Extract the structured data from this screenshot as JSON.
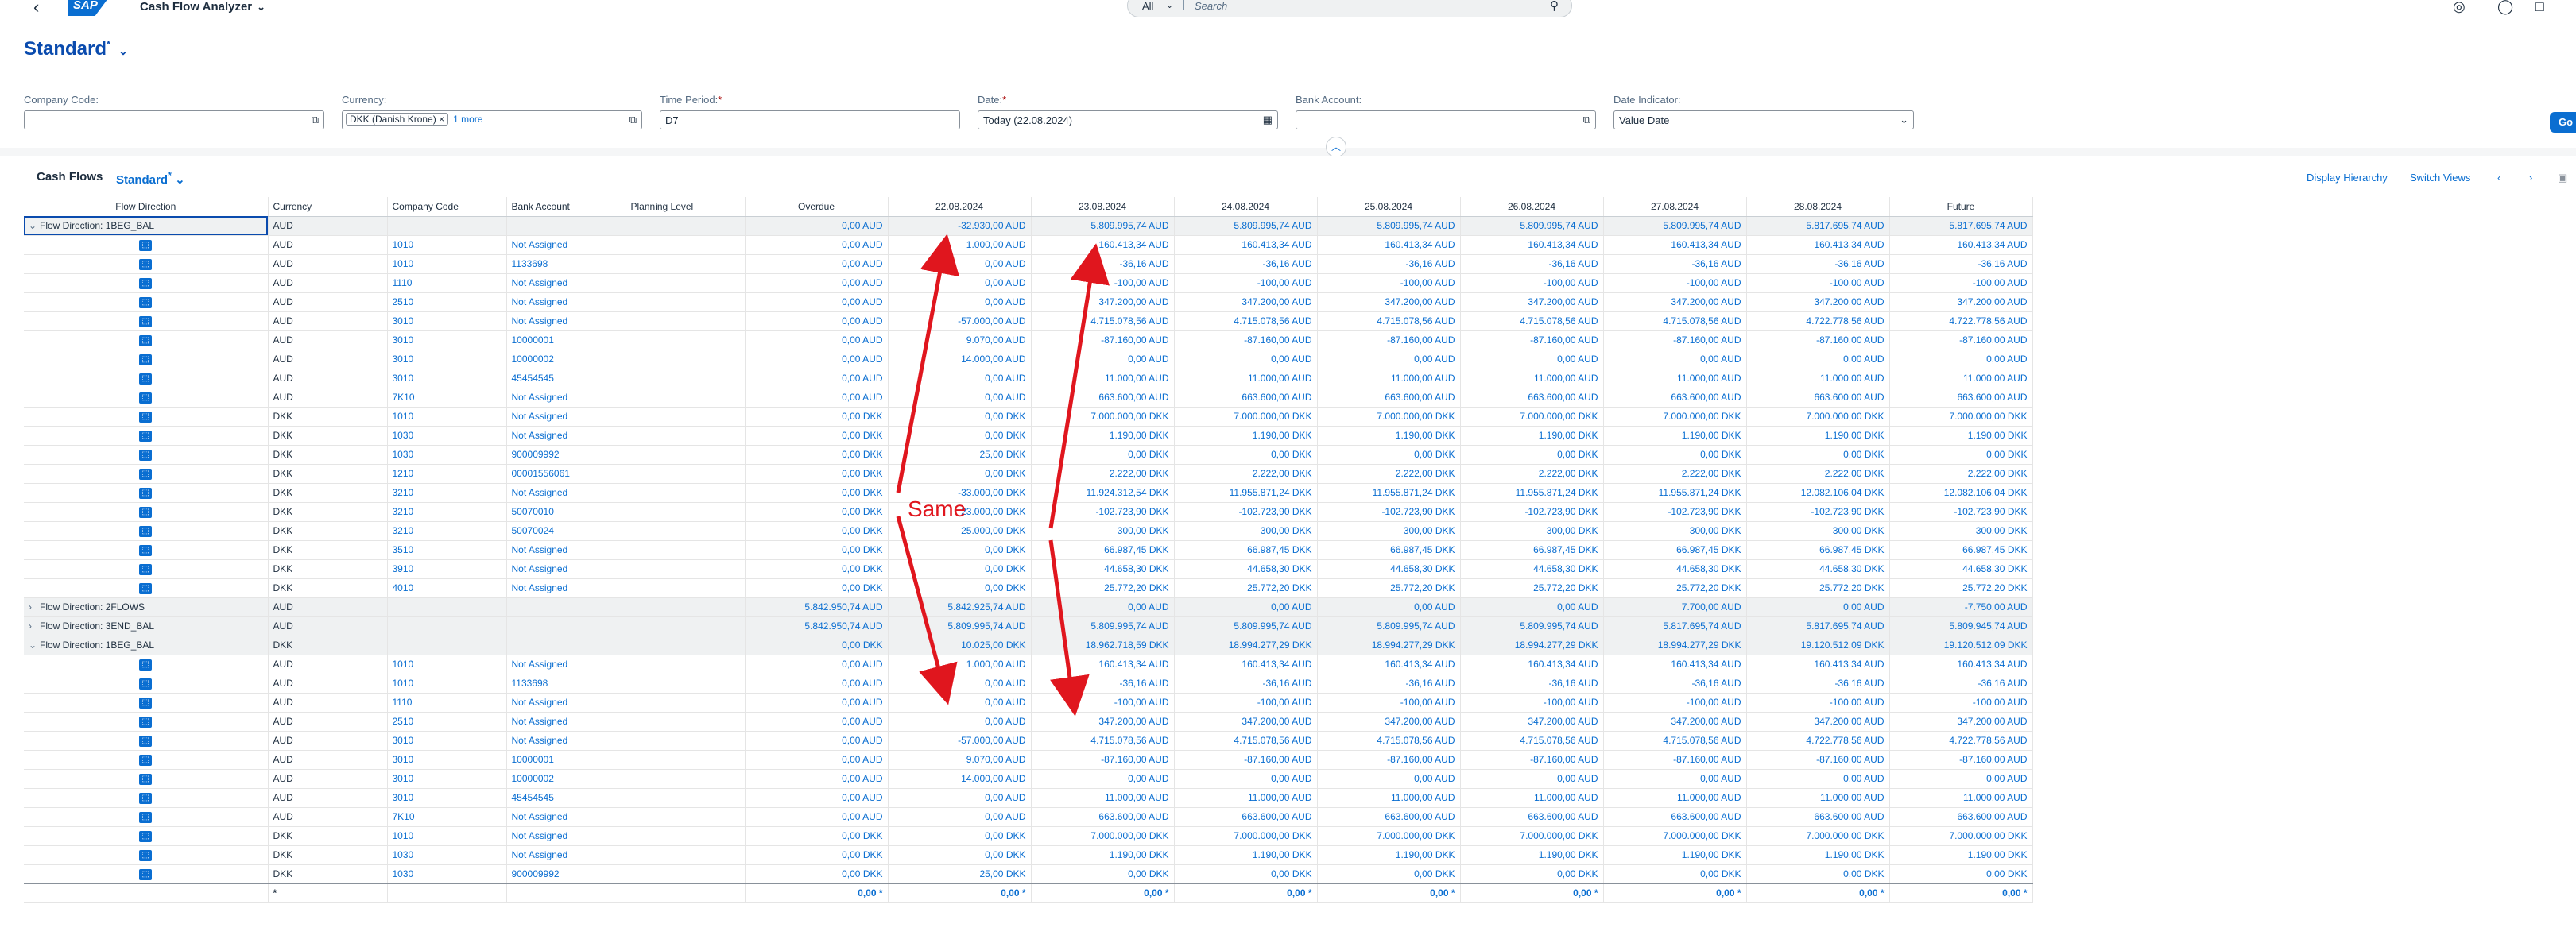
{
  "shell": {
    "app_title": "Cash Flow Analyzer",
    "search_scope": "All",
    "search_placeholder": "Search"
  },
  "header": {
    "variant": "Standard",
    "variant_mark": "*",
    "filters": {
      "company_code": {
        "label": "Company Code:",
        "value": ""
      },
      "currency": {
        "label": "Currency:",
        "token": "DKK (Danish Krone)",
        "more": "1 more"
      },
      "time_period": {
        "label": "Time Period:",
        "req": "*",
        "value": "D7"
      },
      "date": {
        "label": "Date:",
        "req": "*",
        "value": "Today (22.08.2024)"
      },
      "bank_account": {
        "label": "Bank Account:",
        "value": ""
      },
      "date_indicator": {
        "label": "Date Indicator:",
        "value": "Value Date"
      }
    },
    "go_label": "Go"
  },
  "table": {
    "title": "Cash Flows",
    "variant": "Standard",
    "variant_mark": "*",
    "toolbar": {
      "display_hierarchy": "Display Hierarchy",
      "switch_views": "Switch Views"
    },
    "columns": [
      "Flow Direction",
      "Currency",
      "Company Code",
      "Bank Account",
      "Planning Level",
      "Overdue",
      "22.08.2024",
      "23.08.2024",
      "24.08.2024",
      "25.08.2024",
      "26.08.2024",
      "27.08.2024",
      "28.08.2024",
      "Future"
    ],
    "rows": [
      {
        "type": "group",
        "dir": "Flow Direction: 1BEG_BAL",
        "exp": "v",
        "cur": "AUD",
        "vals": [
          "0,00 AUD",
          "-32.930,00 AUD",
          "5.809.995,74 AUD",
          "5.809.995,74 AUD",
          "5.809.995,74 AUD",
          "5.809.995,74 AUD",
          "5.809.995,74 AUD",
          "5.817.695,74 AUD",
          "5.817.695,74 AUD"
        ]
      },
      {
        "type": "item",
        "cur": "AUD",
        "cc": "1010",
        "ba": "Not Assigned",
        "vals": [
          "0,00 AUD",
          "1.000,00 AUD",
          "160.413,34 AUD",
          "160.413,34 AUD",
          "160.413,34 AUD",
          "160.413,34 AUD",
          "160.413,34 AUD",
          "160.413,34 AUD",
          "160.413,34 AUD"
        ]
      },
      {
        "type": "item",
        "cur": "AUD",
        "cc": "1010",
        "ba": "1133698",
        "vals": [
          "0,00 AUD",
          "0,00 AUD",
          "-36,16 AUD",
          "-36,16 AUD",
          "-36,16 AUD",
          "-36,16 AUD",
          "-36,16 AUD",
          "-36,16 AUD",
          "-36,16 AUD"
        ]
      },
      {
        "type": "item",
        "cur": "AUD",
        "cc": "1110",
        "ba": "Not Assigned",
        "vals": [
          "0,00 AUD",
          "0,00 AUD",
          "-100,00 AUD",
          "-100,00 AUD",
          "-100,00 AUD",
          "-100,00 AUD",
          "-100,00 AUD",
          "-100,00 AUD",
          "-100,00 AUD"
        ]
      },
      {
        "type": "item",
        "cur": "AUD",
        "cc": "2510",
        "ba": "Not Assigned",
        "vals": [
          "0,00 AUD",
          "0,00 AUD",
          "347.200,00 AUD",
          "347.200,00 AUD",
          "347.200,00 AUD",
          "347.200,00 AUD",
          "347.200,00 AUD",
          "347.200,00 AUD",
          "347.200,00 AUD"
        ]
      },
      {
        "type": "item",
        "cur": "AUD",
        "cc": "3010",
        "ba": "Not Assigned",
        "vals": [
          "0,00 AUD",
          "-57.000,00 AUD",
          "4.715.078,56 AUD",
          "4.715.078,56 AUD",
          "4.715.078,56 AUD",
          "4.715.078,56 AUD",
          "4.715.078,56 AUD",
          "4.722.778,56 AUD",
          "4.722.778,56 AUD"
        ]
      },
      {
        "type": "item",
        "cur": "AUD",
        "cc": "3010",
        "ba": "10000001",
        "vals": [
          "0,00 AUD",
          "9.070,00 AUD",
          "-87.160,00 AUD",
          "-87.160,00 AUD",
          "-87.160,00 AUD",
          "-87.160,00 AUD",
          "-87.160,00 AUD",
          "-87.160,00 AUD",
          "-87.160,00 AUD"
        ]
      },
      {
        "type": "item",
        "cur": "AUD",
        "cc": "3010",
        "ba": "10000002",
        "vals": [
          "0,00 AUD",
          "14.000,00 AUD",
          "0,00 AUD",
          "0,00 AUD",
          "0,00 AUD",
          "0,00 AUD",
          "0,00 AUD",
          "0,00 AUD",
          "0,00 AUD"
        ]
      },
      {
        "type": "item",
        "cur": "AUD",
        "cc": "3010",
        "ba": "45454545",
        "vals": [
          "0,00 AUD",
          "0,00 AUD",
          "11.000,00 AUD",
          "11.000,00 AUD",
          "11.000,00 AUD",
          "11.000,00 AUD",
          "11.000,00 AUD",
          "11.000,00 AUD",
          "11.000,00 AUD"
        ]
      },
      {
        "type": "item",
        "cur": "AUD",
        "cc": "7K10",
        "ba": "Not Assigned",
        "vals": [
          "0,00 AUD",
          "0,00 AUD",
          "663.600,00 AUD",
          "663.600,00 AUD",
          "663.600,00 AUD",
          "663.600,00 AUD",
          "663.600,00 AUD",
          "663.600,00 AUD",
          "663.600,00 AUD"
        ]
      },
      {
        "type": "item",
        "cur": "DKK",
        "cc": "1010",
        "ba": "Not Assigned",
        "vals": [
          "0,00 DKK",
          "0,00 DKK",
          "7.000.000,00 DKK",
          "7.000.000,00 DKK",
          "7.000.000,00 DKK",
          "7.000.000,00 DKK",
          "7.000.000,00 DKK",
          "7.000.000,00 DKK",
          "7.000.000,00 DKK"
        ]
      },
      {
        "type": "item",
        "cur": "DKK",
        "cc": "1030",
        "ba": "Not Assigned",
        "vals": [
          "0,00 DKK",
          "0,00 DKK",
          "1.190,00 DKK",
          "1.190,00 DKK",
          "1.190,00 DKK",
          "1.190,00 DKK",
          "1.190,00 DKK",
          "1.190,00 DKK",
          "1.190,00 DKK"
        ]
      },
      {
        "type": "item",
        "cur": "DKK",
        "cc": "1030",
        "ba": "900009992",
        "vals": [
          "0,00 DKK",
          "25,00 DKK",
          "0,00 DKK",
          "0,00 DKK",
          "0,00 DKK",
          "0,00 DKK",
          "0,00 DKK",
          "0,00 DKK",
          "0,00 DKK"
        ]
      },
      {
        "type": "item",
        "cur": "DKK",
        "cc": "1210",
        "ba": "00001556061",
        "vals": [
          "0,00 DKK",
          "0,00 DKK",
          "2.222,00 DKK",
          "2.222,00 DKK",
          "2.222,00 DKK",
          "2.222,00 DKK",
          "2.222,00 DKK",
          "2.222,00 DKK",
          "2.222,00 DKK"
        ]
      },
      {
        "type": "item",
        "cur": "DKK",
        "cc": "3210",
        "ba": "Not Assigned",
        "vals": [
          "0,00 DKK",
          "-33.000,00 DKK",
          "11.924.312,54 DKK",
          "11.955.871,24 DKK",
          "11.955.871,24 DKK",
          "11.955.871,24 DKK",
          "11.955.871,24 DKK",
          "12.082.106,04 DKK",
          "12.082.106,04 DKK"
        ]
      },
      {
        "type": "item",
        "cur": "DKK",
        "cc": "3210",
        "ba": "50070010",
        "vals": [
          "0,00 DKK",
          "23.000,00 DKK",
          "-102.723,90 DKK",
          "-102.723,90 DKK",
          "-102.723,90 DKK",
          "-102.723,90 DKK",
          "-102.723,90 DKK",
          "-102.723,90 DKK",
          "-102.723,90 DKK"
        ]
      },
      {
        "type": "item",
        "cur": "DKK",
        "cc": "3210",
        "ba": "50070024",
        "vals": [
          "0,00 DKK",
          "25.000,00 DKK",
          "300,00 DKK",
          "300,00 DKK",
          "300,00 DKK",
          "300,00 DKK",
          "300,00 DKK",
          "300,00 DKK",
          "300,00 DKK"
        ]
      },
      {
        "type": "item",
        "cur": "DKK",
        "cc": "3510",
        "ba": "Not Assigned",
        "vals": [
          "0,00 DKK",
          "0,00 DKK",
          "66.987,45 DKK",
          "66.987,45 DKK",
          "66.987,45 DKK",
          "66.987,45 DKK",
          "66.987,45 DKK",
          "66.987,45 DKK",
          "66.987,45 DKK"
        ]
      },
      {
        "type": "item",
        "cur": "DKK",
        "cc": "3910",
        "ba": "Not Assigned",
        "vals": [
          "0,00 DKK",
          "0,00 DKK",
          "44.658,30 DKK",
          "44.658,30 DKK",
          "44.658,30 DKK",
          "44.658,30 DKK",
          "44.658,30 DKK",
          "44.658,30 DKK",
          "44.658,30 DKK"
        ]
      },
      {
        "type": "item",
        "cur": "DKK",
        "cc": "4010",
        "ba": "Not Assigned",
        "vals": [
          "0,00 DKK",
          "0,00 DKK",
          "25.772,20 DKK",
          "25.772,20 DKK",
          "25.772,20 DKK",
          "25.772,20 DKK",
          "25.772,20 DKK",
          "25.772,20 DKK",
          "25.772,20 DKK"
        ]
      },
      {
        "type": "group",
        "dir": "Flow Direction: 2FLOWS",
        "exp": ">",
        "cur": "AUD",
        "vals": [
          "5.842.950,74 AUD",
          "5.842.925,74 AUD",
          "0,00 AUD",
          "0,00 AUD",
          "0,00 AUD",
          "0,00 AUD",
          "7.700,00 AUD",
          "0,00 AUD",
          "-7.750,00 AUD"
        ]
      },
      {
        "type": "group",
        "dir": "Flow Direction: 3END_BAL",
        "exp": ">",
        "cur": "AUD",
        "vals": [
          "5.842.950,74 AUD",
          "5.809.995,74 AUD",
          "5.809.995,74 AUD",
          "5.809.995,74 AUD",
          "5.809.995,74 AUD",
          "5.809.995,74 AUD",
          "5.817.695,74 AUD",
          "5.817.695,74 AUD",
          "5.809.945,74 AUD"
        ]
      },
      {
        "type": "group",
        "dir": "Flow Direction: 1BEG_BAL",
        "exp": "v",
        "cur": "DKK",
        "vals": [
          "0,00 DKK",
          "10.025,00 DKK",
          "18.962.718,59 DKK",
          "18.994.277,29 DKK",
          "18.994.277,29 DKK",
          "18.994.277,29 DKK",
          "18.994.277,29 DKK",
          "19.120.512,09 DKK",
          "19.120.512,09 DKK"
        ]
      },
      {
        "type": "item",
        "cur": "AUD",
        "cc": "1010",
        "ba": "Not Assigned",
        "vals": [
          "0,00 AUD",
          "1.000,00 AUD",
          "160.413,34 AUD",
          "160.413,34 AUD",
          "160.413,34 AUD",
          "160.413,34 AUD",
          "160.413,34 AUD",
          "160.413,34 AUD",
          "160.413,34 AUD"
        ]
      },
      {
        "type": "item",
        "cur": "AUD",
        "cc": "1010",
        "ba": "1133698",
        "vals": [
          "0,00 AUD",
          "0,00 AUD",
          "-36,16 AUD",
          "-36,16 AUD",
          "-36,16 AUD",
          "-36,16 AUD",
          "-36,16 AUD",
          "-36,16 AUD",
          "-36,16 AUD"
        ]
      },
      {
        "type": "item",
        "cur": "AUD",
        "cc": "1110",
        "ba": "Not Assigned",
        "vals": [
          "0,00 AUD",
          "0,00 AUD",
          "-100,00 AUD",
          "-100,00 AUD",
          "-100,00 AUD",
          "-100,00 AUD",
          "-100,00 AUD",
          "-100,00 AUD",
          "-100,00 AUD"
        ]
      },
      {
        "type": "item",
        "cur": "AUD",
        "cc": "2510",
        "ba": "Not Assigned",
        "vals": [
          "0,00 AUD",
          "0,00 AUD",
          "347.200,00 AUD",
          "347.200,00 AUD",
          "347.200,00 AUD",
          "347.200,00 AUD",
          "347.200,00 AUD",
          "347.200,00 AUD",
          "347.200,00 AUD"
        ]
      },
      {
        "type": "item",
        "cur": "AUD",
        "cc": "3010",
        "ba": "Not Assigned",
        "vals": [
          "0,00 AUD",
          "-57.000,00 AUD",
          "4.715.078,56 AUD",
          "4.715.078,56 AUD",
          "4.715.078,56 AUD",
          "4.715.078,56 AUD",
          "4.715.078,56 AUD",
          "4.722.778,56 AUD",
          "4.722.778,56 AUD"
        ]
      },
      {
        "type": "item",
        "cur": "AUD",
        "cc": "3010",
        "ba": "10000001",
        "vals": [
          "0,00 AUD",
          "9.070,00 AUD",
          "-87.160,00 AUD",
          "-87.160,00 AUD",
          "-87.160,00 AUD",
          "-87.160,00 AUD",
          "-87.160,00 AUD",
          "-87.160,00 AUD",
          "-87.160,00 AUD"
        ]
      },
      {
        "type": "item",
        "cur": "AUD",
        "cc": "3010",
        "ba": "10000002",
        "vals": [
          "0,00 AUD",
          "14.000,00 AUD",
          "0,00 AUD",
          "0,00 AUD",
          "0,00 AUD",
          "0,00 AUD",
          "0,00 AUD",
          "0,00 AUD",
          "0,00 AUD"
        ]
      },
      {
        "type": "item",
        "cur": "AUD",
        "cc": "3010",
        "ba": "45454545",
        "vals": [
          "0,00 AUD",
          "0,00 AUD",
          "11.000,00 AUD",
          "11.000,00 AUD",
          "11.000,00 AUD",
          "11.000,00 AUD",
          "11.000,00 AUD",
          "11.000,00 AUD",
          "11.000,00 AUD"
        ]
      },
      {
        "type": "item",
        "cur": "AUD",
        "cc": "7K10",
        "ba": "Not Assigned",
        "vals": [
          "0,00 AUD",
          "0,00 AUD",
          "663.600,00 AUD",
          "663.600,00 AUD",
          "663.600,00 AUD",
          "663.600,00 AUD",
          "663.600,00 AUD",
          "663.600,00 AUD",
          "663.600,00 AUD"
        ]
      },
      {
        "type": "item",
        "cur": "DKK",
        "cc": "1010",
        "ba": "Not Assigned",
        "vals": [
          "0,00 DKK",
          "0,00 DKK",
          "7.000.000,00 DKK",
          "7.000.000,00 DKK",
          "7.000.000,00 DKK",
          "7.000.000,00 DKK",
          "7.000.000,00 DKK",
          "7.000.000,00 DKK",
          "7.000.000,00 DKK"
        ]
      },
      {
        "type": "item",
        "cur": "DKK",
        "cc": "1030",
        "ba": "Not Assigned",
        "vals": [
          "0,00 DKK",
          "0,00 DKK",
          "1.190,00 DKK",
          "1.190,00 DKK",
          "1.190,00 DKK",
          "1.190,00 DKK",
          "1.190,00 DKK",
          "1.190,00 DKK",
          "1.190,00 DKK"
        ]
      },
      {
        "type": "item",
        "cur": "DKK",
        "cc": "1030",
        "ba": "900009992",
        "vals": [
          "0,00 DKK",
          "25,00 DKK",
          "0,00 DKK",
          "0,00 DKK",
          "0,00 DKK",
          "0,00 DKK",
          "0,00 DKK",
          "0,00 DKK",
          "0,00 DKK"
        ]
      }
    ],
    "footer": {
      "cur": "*",
      "vals": [
        "0,00 *",
        "0,00 *",
        "0,00 *",
        "0,00 *",
        "0,00 *",
        "0,00 *",
        "0,00 *",
        "0,00 *",
        "0,00 *"
      ]
    }
  },
  "annotation": {
    "text": "Same",
    "color": "#e0161e"
  }
}
